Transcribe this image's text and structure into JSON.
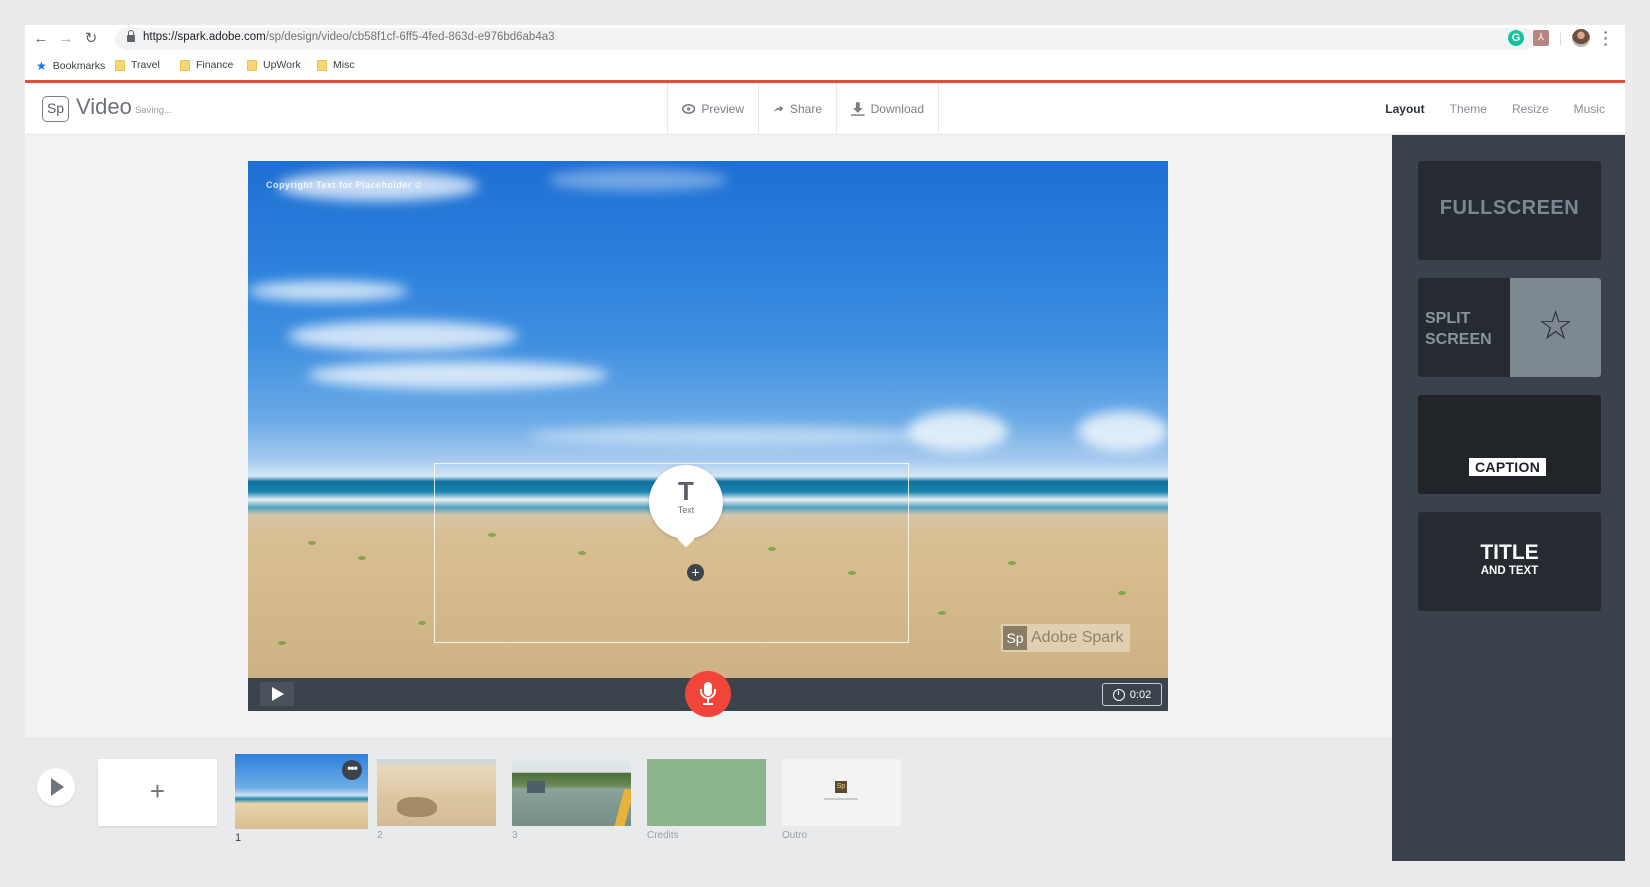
{
  "browser": {
    "url_host": "https://spark.adobe.com",
    "url_path": "/sp/design/video/cb58f1cf-6ff5-4fed-863d-e976bd6ab4a3",
    "bookmarks": [
      {
        "label": "Bookmarks",
        "icon": "star-icon"
      },
      {
        "label": "Travel",
        "icon": "folder-icon"
      },
      {
        "label": "Finance",
        "icon": "folder-icon"
      },
      {
        "label": "UpWork",
        "icon": "folder-icon"
      },
      {
        "label": "Misc",
        "icon": "folder-icon"
      }
    ],
    "extensions": {
      "grammarly": "G",
      "acrobat": "⅄"
    }
  },
  "app": {
    "logo": "Sp",
    "title": "Video",
    "status": "Saving...",
    "actions": [
      {
        "label": "Preview",
        "icon": "eye-icon"
      },
      {
        "label": "Share",
        "icon": "share-arrow-icon"
      },
      {
        "label": "Download",
        "icon": "download-icon"
      }
    ],
    "tabs": [
      {
        "label": "Layout",
        "active": true
      },
      {
        "label": "Theme",
        "active": false
      },
      {
        "label": "Resize",
        "active": false
      },
      {
        "label": "Music",
        "active": false
      }
    ],
    "accent_color": "#e34f3f"
  },
  "canvas": {
    "copyright_overlay": "Copyright Text for Placeholder ©",
    "text_placeholder": {
      "glyph": "T",
      "label": "Text"
    },
    "add_button": "+",
    "watermark": {
      "logo": "Sp",
      "text": "Adobe Spark"
    },
    "timer": "0:02",
    "mic_color": "#f2453a"
  },
  "timeline": {
    "add_label": "+",
    "slides": [
      {
        "label": "1",
        "selected": true,
        "thumb": "beach"
      },
      {
        "label": "2",
        "selected": false,
        "thumb": "sand"
      },
      {
        "label": "3",
        "selected": false,
        "thumb": "river"
      },
      {
        "label": "Credits",
        "selected": false,
        "thumb": "credits"
      },
      {
        "label": "Outro",
        "selected": false,
        "thumb": "outro"
      }
    ],
    "more_label": "•••"
  },
  "layouts": {
    "fullscreen": "FULLSCREEN",
    "split_line1": "SPLIT",
    "split_line2": "SCREEN",
    "split_icon": "☆",
    "caption": "CAPTION",
    "title": "TITLE",
    "title_sub": "AND TEXT"
  }
}
